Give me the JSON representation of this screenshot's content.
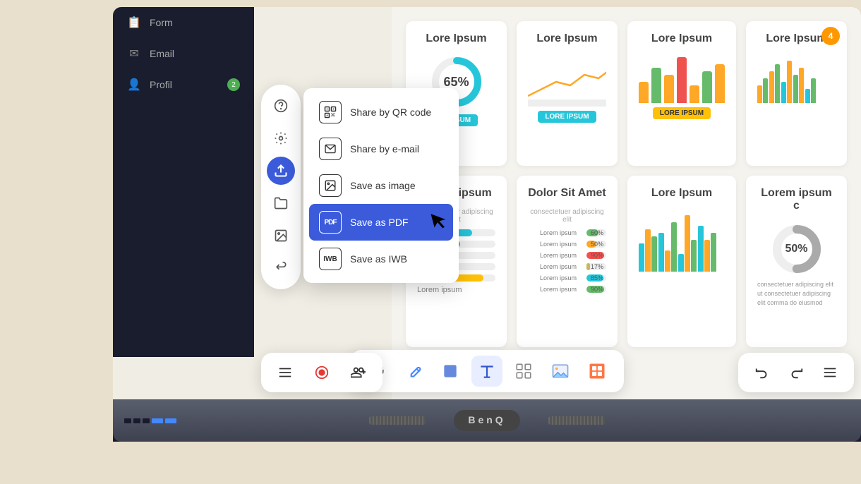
{
  "monitor": {
    "brand": "BenQ"
  },
  "sidebar": {
    "items": [
      {
        "label": "Form",
        "icon": "📋"
      },
      {
        "label": "Email",
        "icon": "✉"
      },
      {
        "label": "Profil",
        "icon": "👤",
        "badge": "2"
      }
    ]
  },
  "floating_toolbar": {
    "buttons": [
      {
        "id": "help",
        "icon": "?",
        "active": false
      },
      {
        "id": "settings",
        "icon": "⚙",
        "active": false
      },
      {
        "id": "upload",
        "icon": "↑",
        "active": true
      },
      {
        "id": "folder",
        "icon": "🗂",
        "active": false
      },
      {
        "id": "gallery",
        "icon": "🖼",
        "active": false
      },
      {
        "id": "exit",
        "icon": "⮐",
        "active": false
      }
    ]
  },
  "context_menu": {
    "items": [
      {
        "id": "share-qr",
        "label": "Share by QR code",
        "icon": "QR",
        "selected": false
      },
      {
        "id": "share-email",
        "label": "Share by e-mail",
        "icon": "✉",
        "selected": false
      },
      {
        "id": "save-image",
        "label": "Save as image",
        "icon": "🖼",
        "selected": false
      },
      {
        "id": "save-pdf",
        "label": "Save as PDF",
        "icon": "PDF",
        "selected": true
      },
      {
        "id": "save-iwb",
        "label": "Save as IWB",
        "icon": "IWB",
        "selected": false
      }
    ]
  },
  "dashboard": {
    "cards": [
      {
        "id": "card1",
        "title": "Lore Ipsum",
        "type": "donut",
        "value": "65%",
        "badge": {
          "text": "E IPSUM",
          "color": "#26c6da"
        }
      },
      {
        "id": "card2",
        "title": "Lore Ipsum",
        "type": "line",
        "badge": {
          "text": "LORE IPSUM",
          "color": "#26c6da"
        }
      },
      {
        "id": "card3",
        "title": "Lore Ipsum",
        "type": "bar",
        "badge": {
          "text": "LORE IPSUM",
          "color": "#ffc107"
        }
      },
      {
        "id": "card4",
        "title": "Lore Ipsum",
        "type": "multibar",
        "badge_right": "4"
      },
      {
        "id": "card5",
        "title": "Lorem ipsum",
        "subtitle": "consectetuer adipiscing elit",
        "type": "hbars"
      },
      {
        "id": "card6",
        "title": "Dolor Sit Amet",
        "subtitle": "consectetuer adipiscing elit",
        "type": "hbars2"
      },
      {
        "id": "card7",
        "title": "Lore Ipsum",
        "type": "vbars2"
      },
      {
        "id": "card8",
        "title": "Lorem ipsum c",
        "type": "donut2",
        "value": "50%"
      }
    ],
    "hbars": [
      {
        "label": "Lorem ipsum",
        "color": "#26c6da",
        "pct": 70,
        "pct_label": ""
      },
      {
        "label": "Lorem ipsum",
        "color": "#66bb6a",
        "pct": 55,
        "pct_label": ""
      },
      {
        "label": "Lorem ipsum",
        "color": "#ffa726",
        "pct": 40,
        "pct_label": ""
      },
      {
        "label": "Lorem ipsum",
        "color": "#ef5350",
        "pct": 25,
        "pct_label": ""
      },
      {
        "label": "Lorem ipsum",
        "color": "#ffc107",
        "pct": 85,
        "pct_label": ""
      }
    ],
    "hbars2": [
      {
        "label": "Lorem ipsum",
        "color": "#66bb6a",
        "pct": 60,
        "pct_label": "60%"
      },
      {
        "label": "Lorem ipsum",
        "color": "#ffa726",
        "pct": 50,
        "pct_label": "50%"
      },
      {
        "label": "Lorem ipsum",
        "color": "#ef5350",
        "pct": 90,
        "pct_label": "90%"
      },
      {
        "label": "Lorem ipsum",
        "color": "#c9b85a",
        "pct": 17,
        "pct_label": "17%"
      },
      {
        "label": "Lorem ipsum",
        "color": "#26c6da",
        "pct": 85,
        "pct_label": "85%"
      },
      {
        "label": "Lorem ipsum",
        "color": "#66bb6a",
        "pct": 90,
        "pct_label": "90%"
      }
    ]
  },
  "bottom_toolbar": {
    "tools": [
      {
        "id": "lasso",
        "icon": "⊙",
        "active": false
      },
      {
        "id": "pen",
        "icon": "✒",
        "active": false
      },
      {
        "id": "shape",
        "icon": "⬛",
        "active": false
      },
      {
        "id": "text",
        "icon": "T",
        "active": true
      },
      {
        "id": "select",
        "icon": "⊕",
        "active": false
      },
      {
        "id": "image",
        "icon": "🖼",
        "active": false
      },
      {
        "id": "widget",
        "icon": "🧰",
        "active": false
      }
    ]
  },
  "bottom_controls": {
    "menu_icon": "☰",
    "record_icon": "⏺",
    "user_add_icon": "👤+"
  },
  "right_controls": {
    "undo": "↩",
    "redo": "↪",
    "more": "☰"
  }
}
